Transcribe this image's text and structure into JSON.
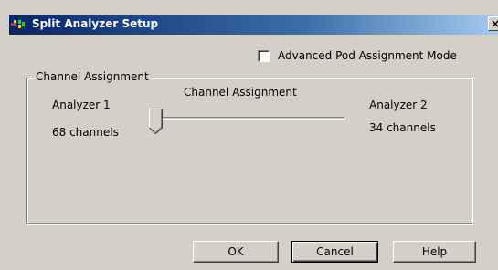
{
  "window": {
    "title": "Split Analyzer Setup",
    "close_label": "×",
    "icon": "agilent-logic-analyzer-icon"
  },
  "options": {
    "advanced_mode_label": "Advanced Pod Assignment Mode",
    "advanced_mode_checked": false
  },
  "group": {
    "legend": "Channel Assignment",
    "slider_title": "Channel Assignment",
    "slider_value": 0,
    "analyzer1": {
      "label": "Analyzer 1",
      "count": "68 channels"
    },
    "analyzer2": {
      "label": "Analyzer 2",
      "count": "34 channels"
    }
  },
  "buttons": {
    "ok": "OK",
    "cancel": "Cancel",
    "help": "Help"
  },
  "colors": {
    "dialog_face": "#d4d0c8",
    "titlebar_start": "#0a246a",
    "titlebar_end": "#a6caf0"
  }
}
